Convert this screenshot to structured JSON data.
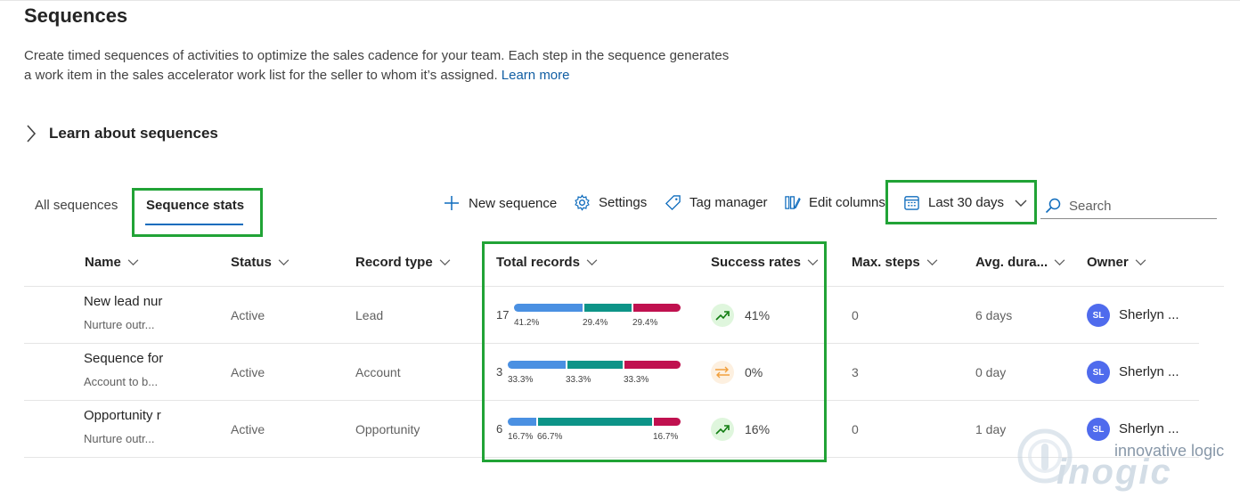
{
  "page": {
    "title": "Sequences",
    "description": "Create timed sequences of activities to optimize the sales cadence for your team. Each step in the sequence generates a work item in the sales accelerator work list for the seller to whom it’s assigned.",
    "learn_more": "Learn more",
    "learn_about": "Learn about sequences"
  },
  "tabs": [
    {
      "label": "All sequences",
      "active": false
    },
    {
      "label": "Sequence stats",
      "active": true
    }
  ],
  "commands": {
    "new_sequence": "New sequence",
    "settings": "Settings",
    "tag_manager": "Tag manager",
    "edit_columns": "Edit columns",
    "date_filter": "Last 30 days",
    "search_placeholder": "Search"
  },
  "columns": [
    "Name",
    "Status",
    "Record type",
    "Total records",
    "Success rates",
    "Max. steps",
    "Avg. dura...",
    "Owner"
  ],
  "rows": [
    {
      "name": "New lead nur",
      "subtitle": "Nurture outr...",
      "status": "Active",
      "record_type": "Lead",
      "total": "17",
      "segments": [
        41.2,
        29.4,
        29.4
      ],
      "segment_labels": [
        "41.2%",
        "29.4%",
        "29.4%"
      ],
      "rate_icon": "trending-up-icon",
      "success_rate": "41%",
      "max_steps": "0",
      "avg_duration": "6 days",
      "owner_initials": "SL",
      "owner": "Sherlyn ..."
    },
    {
      "name": "Sequence for",
      "subtitle": "Account to b...",
      "status": "Active",
      "record_type": "Account",
      "total": "3",
      "segments": [
        33.3,
        33.3,
        33.3
      ],
      "segment_labels": [
        "33.3%",
        "33.3%",
        "33.3%"
      ],
      "rate_icon": "neutral-arrows-icon",
      "success_rate": "0%",
      "max_steps": "3",
      "avg_duration": "0 day",
      "owner_initials": "SL",
      "owner": "Sherlyn ..."
    },
    {
      "name": "Opportunity r",
      "subtitle": "Nurture outr...",
      "status": "Active",
      "record_type": "Opportunity",
      "total": "6",
      "segments": [
        16.7,
        66.7,
        16.7
      ],
      "segment_labels": [
        "16.7%",
        "66.7%",
        "16.7%"
      ],
      "rate_icon": "trending-up-icon",
      "success_rate": "16%",
      "max_steps": "0",
      "avg_duration": "1 day",
      "owner_initials": "SL",
      "owner": "Sherlyn ..."
    }
  ],
  "segment_colors": [
    "#4a90e2",
    "#0d9488",
    "#c0114f"
  ],
  "highlight_color": "#21a336",
  "watermark": {
    "tagline": "innovative logic",
    "brand": "inogic"
  }
}
